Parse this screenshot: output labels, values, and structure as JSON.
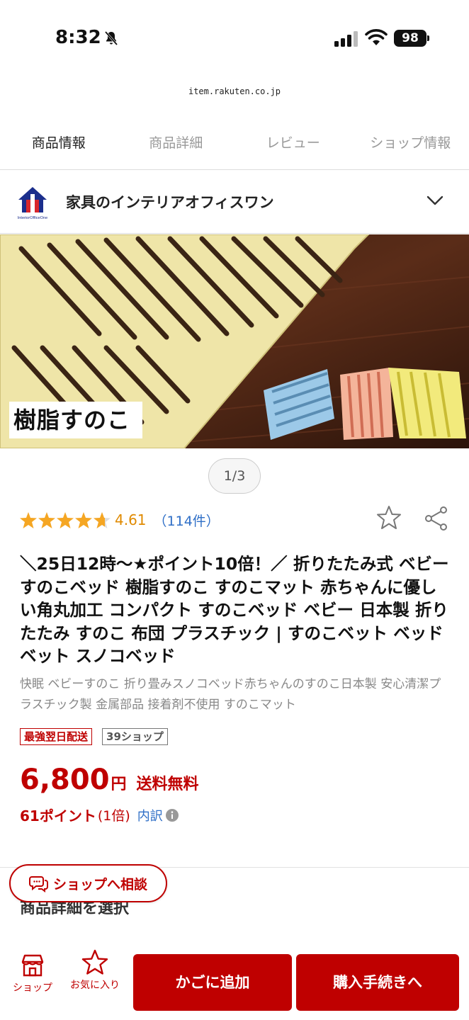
{
  "status_bar": {
    "time": "8:32",
    "battery": "98"
  },
  "browser": {
    "url": "item.rakuten.co.jp"
  },
  "tabs": [
    {
      "label": "商品情報",
      "active": true
    },
    {
      "label": "商品詳細",
      "active": false
    },
    {
      "label": "レビュー",
      "active": false
    },
    {
      "label": "ショップ情報",
      "active": false
    }
  ],
  "shop": {
    "name": "家具のインテリアオフィスワン",
    "logo_text": "InteriorOfficeOne"
  },
  "gallery": {
    "image_label": "樹脂すのこ",
    "page_indicator": "1/3"
  },
  "rating": {
    "value": "4.61",
    "stars": 4.61,
    "count": "（114件）"
  },
  "product": {
    "title": "＼25日12時〜★ポイント10倍！／ 折りたたみ式 ベビーすのこベッド 樹脂すのこ すのこマット 赤ちゃんに優しい角丸加工 コンパクト すのこベッド ベビー 日本製 折りたたみ すのこ 布団 プラスチック | すのこベット ベッド ベット スノコベッド",
    "subtitle": "快眠 ベビーすのこ 折り畳みスノコベッド赤ちゃんのすのこ日本製 安心清潔プラスチック製 金属部品 接着剤不使用 すのこマット",
    "badges": {
      "delivery": "最強翌日配送",
      "shop39": "39ショップ"
    },
    "price": "6,800",
    "currency": "円",
    "shipping": "送料無料",
    "points": "61ポイント",
    "points_multiplier": "(1倍)",
    "breakdown_label": "内訳"
  },
  "consult_button": "ショップへ相談",
  "section_title": "商品詳細を選択",
  "bottom_bar": {
    "shop_label": "ショップ",
    "favorite_label": "お気に入り",
    "cart_button": "かごに追加",
    "buy_button": "購入手続きへ"
  },
  "colors": {
    "accent": "#bf0000",
    "link": "#2f6fc7",
    "star": "#f5a623"
  }
}
